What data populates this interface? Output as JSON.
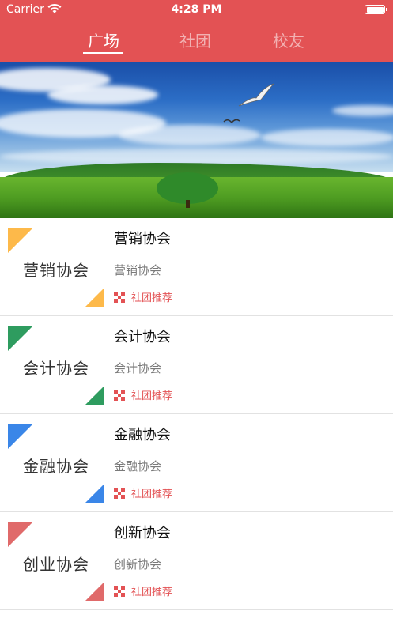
{
  "status_bar": {
    "carrier": "Carrier",
    "time": "4:28 PM"
  },
  "tabs": [
    {
      "label": "广场",
      "active": true
    },
    {
      "label": "社团",
      "active": false
    },
    {
      "label": "校友",
      "active": false
    }
  ],
  "colors": {
    "header": "#e35254",
    "tag": "#e35254"
  },
  "items": [
    {
      "thumb_text": "营销协会",
      "title": "营销协会",
      "subtitle": "营销协会",
      "tag": "社团推荐",
      "accent": "#fdb94a"
    },
    {
      "thumb_text": "会计协会",
      "title": "会计协会",
      "subtitle": "会计协会",
      "tag": "社团推荐",
      "accent": "#2e9c5f"
    },
    {
      "thumb_text": "金融协会",
      "title": "金融协会",
      "subtitle": "金融协会",
      "tag": "社团推荐",
      "accent": "#3a86e8"
    },
    {
      "thumb_text": "创业协会",
      "title": "创新协会",
      "subtitle": "创新协会",
      "tag": "社团推荐",
      "accent": "#e06a6a"
    }
  ]
}
